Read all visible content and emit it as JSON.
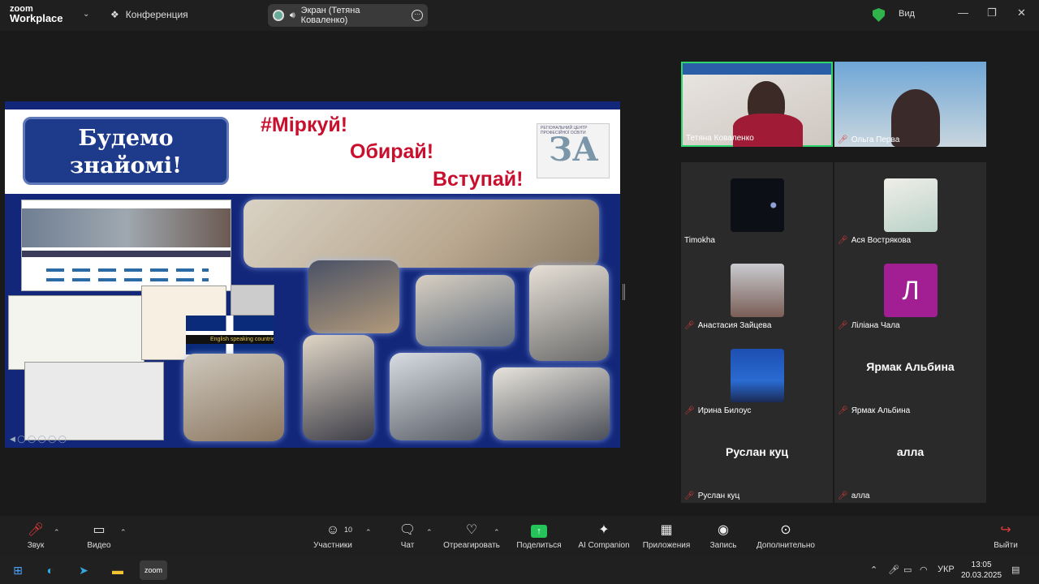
{
  "app": {
    "logo_line1": "zoom",
    "logo_line2": "Workplace",
    "meeting_label": "Конференция"
  },
  "share_pill": {
    "label": "Экран (Тетяна  Коваленко)"
  },
  "header_right": {
    "view_label": "Вид"
  },
  "slide": {
    "hello_line1": "Будемо",
    "hello_line2": "знайомі!",
    "slogan1": "#Міркуй!",
    "slogan2": "Обирай!",
    "slogan3": "Вступай!",
    "logo_letters": "ЗА",
    "logo_caption": "РЕГІОНАЛЬНИЙ ЦЕНТР ПРОФЕСІЙНОЇ ОСВІТИ",
    "flag_caption": "English speaking countries"
  },
  "participants": [
    {
      "name": "Тетяна  Коваленко",
      "muted": false,
      "kind": "video"
    },
    {
      "name": "Ольга Перва",
      "muted": true,
      "kind": "video"
    },
    {
      "name": "Timokha",
      "muted": false,
      "kind": "avatar"
    },
    {
      "name": "Ася Вострякова",
      "muted": true,
      "kind": "avatar"
    },
    {
      "name": "Анастасия Зайцева",
      "muted": true,
      "kind": "avatar"
    },
    {
      "name": "Ліліана Чала",
      "muted": true,
      "kind": "letter",
      "letter": "Л"
    },
    {
      "name": "Ирина Билоус",
      "muted": true,
      "kind": "avatar"
    },
    {
      "name": "Ярмак Альбина",
      "muted": true,
      "kind": "text",
      "big": "Ярмак Альбина"
    },
    {
      "name": "Руслан куц",
      "muted": true,
      "kind": "text",
      "big": "Руслан куц"
    },
    {
      "name": "алла",
      "muted": true,
      "kind": "text",
      "big": "алла"
    }
  ],
  "toolbar": {
    "audio": "Звук",
    "video": "Видео",
    "participants": "Участники",
    "participants_count": "10",
    "chat": "Чат",
    "react": "Отреагировать",
    "share": "Поделиться",
    "ai": "AI Companion",
    "apps": "Приложения",
    "record": "Запись",
    "more": "Дополнительно",
    "leave": "Выйти"
  },
  "taskbar": {
    "lang": "УКР",
    "time": "13:05",
    "date": "20.03.2025"
  },
  "colors": {
    "accent_green": "#2fd46e",
    "mute_red": "#e23b3b",
    "slogan_red": "#c8102e",
    "slide_blue": "#13277a"
  }
}
